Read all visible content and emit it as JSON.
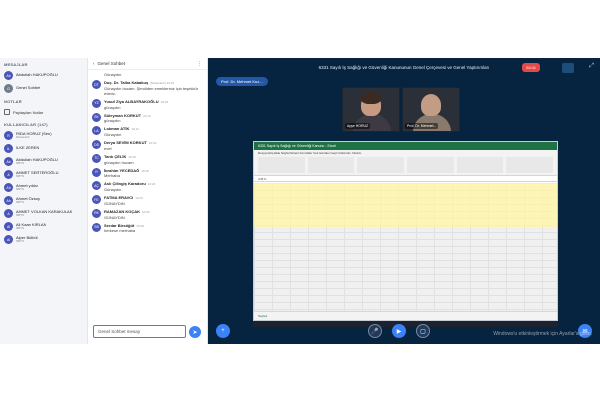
{
  "users": {
    "messages_heading": "MESAJLAR",
    "messages": [
      {
        "initials": "Ab",
        "name": "Abdullah HAKUPOĞLU"
      },
      {
        "initials": "G",
        "name": "Genel Sohbet"
      }
    ],
    "notes_heading": "NOTLAR",
    "shared_notes": "Paylaşılan Notlar",
    "users_heading": "KULLANICILAR (147)",
    "list": [
      {
        "initials": "R",
        "name": "RIDA HORUZ (Sen)",
        "sub": "Moderatör"
      },
      {
        "initials": "İL",
        "name": "İLKE ZEREN",
        "sub": ""
      },
      {
        "initials": "Ab",
        "name": "Abdullah HAKUPOĞLU",
        "sub": "NBTS"
      },
      {
        "initials": "A",
        "name": "AHMET SERTEROĞLU",
        "sub": "NBTS"
      },
      {
        "initials": "Ah",
        "name": "Ahmet yıldız",
        "sub": "NBTS"
      },
      {
        "initials": "Ah",
        "name": "Ahmet Özsoy",
        "sub": "NBTS"
      },
      {
        "initials": "A",
        "name": "AHMET VOLKAN KARAKULAK",
        "sub": "NBTS"
      },
      {
        "initials": "Al",
        "name": "Ali Kaan KIRLAN",
        "sub": "NBTS"
      },
      {
        "initials": "Al",
        "name": "Alper Bülbül",
        "sub": "NBTS"
      }
    ]
  },
  "chat": {
    "title": "Genel Sohbet",
    "back": "‹",
    "menu": "⋮",
    "messages": [
      {
        "initials": "",
        "who": "",
        "time": "",
        "text": "Günaydın"
      },
      {
        "initials": "DT",
        "who": "Doç. Dr. Talha Kabakuş",
        "time": "(Moderatör) 10:01",
        "text": "Günaydın hocam. Şimdiden emekleriniz için teşekkür ederiz."
      },
      {
        "initials": "YZ",
        "who": "Yusuf Ziya ALBAYRAKOĞLU",
        "time": "10:02",
        "text": "günaydın"
      },
      {
        "initials": "SK",
        "who": "Süleyman KORKUT",
        "time": "10:13",
        "text": "günaydın"
      },
      {
        "initials": "LA",
        "who": "Lokman ATİK",
        "time": "10:13",
        "text": "Günaydın"
      },
      {
        "initials": "DS",
        "who": "Derya SEVİM KORKUT",
        "time": "10:14",
        "text": "evet"
      },
      {
        "initials": "TC",
        "who": "Tarık ÇELİK",
        "time": "10:15",
        "text": "günaydın hocam"
      },
      {
        "initials": "İY",
        "who": "İbrahim YECEDAĞ",
        "time": "10:16",
        "text": "Merhaba"
      },
      {
        "initials": "AÇ",
        "who": "Aslı Çilingiş Karadoru",
        "time": "10:22",
        "text": "Günaydın"
      },
      {
        "initials": "FE",
        "who": "FATMA ERAVCI",
        "time": "10:23",
        "text": "GÜNAYDIN"
      },
      {
        "initials": "RK",
        "who": "RAMAZAN KOÇAK",
        "time": "10:26",
        "text": "GÜNAYDIN"
      },
      {
        "initials": "SB",
        "who": "Serdar Birsöğüt",
        "time": "10:28",
        "text": "herkese merhaba"
      }
    ],
    "composer_placeholder": "Genel Sohbet mesajı",
    "send_icon": "➤"
  },
  "stage": {
    "title": "6331 Sayılı İş Sağlığı ve Güvenliği Kanununun Genel Çerçevesi ve Genel Yaptırımları",
    "recording": "54:11",
    "presenter": "Prof. Dr. Mehmet Kuz...",
    "cams": [
      {
        "name": "Ayşe HORUZ"
      },
      {
        "name": "Prof. Dr. Mehmet..."
      }
    ],
    "sheet_title": "6331 Sayılı İş Sağlığı ve Güvenliği Kanunu - Excel",
    "sheet_tabs": "Sayfa1",
    "ribbon_tabs": "Dosya Giriş Ekle Sayfa Düzeni Formüller Veri Gözden Geçir Görünüm Yardım",
    "formula_bar": "A45     fx",
    "watermark": "Windows'u etkinleştirmek için Ayarlar'a gidin.",
    "icons": {
      "plus": "+",
      "mic": "🎤",
      "camera": "▶",
      "screen": "▢",
      "chat": "✉",
      "fullscreen": "⤢"
    }
  }
}
